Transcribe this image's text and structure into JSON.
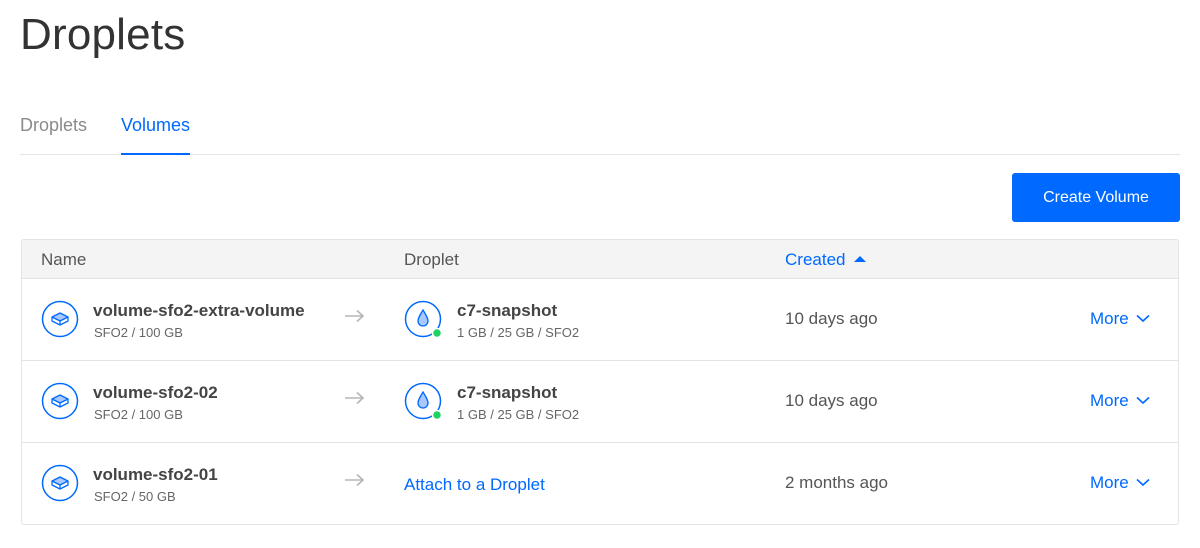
{
  "page": {
    "title": "Droplets"
  },
  "tabs": [
    {
      "label": "Droplets",
      "active": false
    },
    {
      "label": "Volumes",
      "active": true
    }
  ],
  "toolbar": {
    "create_label": "Create Volume"
  },
  "table": {
    "headers": {
      "name": "Name",
      "droplet": "Droplet",
      "created": "Created"
    },
    "sort": {
      "column": "created",
      "direction": "ascending"
    },
    "rows": [
      {
        "volume_name": "volume-sfo2-extra-volume",
        "volume_meta": "SFO2 / 100 GB",
        "droplet_name": "c7-snapshot",
        "droplet_meta": "1 GB / 25 GB / SFO2",
        "droplet_status": "active",
        "created": "10 days ago",
        "more_label": "More"
      },
      {
        "volume_name": "volume-sfo2-02",
        "volume_meta": "SFO2 / 100 GB",
        "droplet_name": "c7-snapshot",
        "droplet_meta": "1 GB / 25 GB / SFO2",
        "droplet_status": "active",
        "created": "10 days ago",
        "more_label": "More"
      },
      {
        "volume_name": "volume-sfo2-01",
        "volume_meta": "SFO2 / 50 GB",
        "attach_label": "Attach to a Droplet",
        "created": "2 months ago",
        "more_label": "More"
      }
    ]
  },
  "colors": {
    "accent": "#0069ff",
    "status_active": "#1fd264",
    "border": "#e3e3e3",
    "header_bg": "#f4f4f4"
  },
  "icons": {
    "volume": "volume-disk-icon",
    "droplet": "droplet-icon",
    "arrow": "arrow-right-icon",
    "chevron": "chevron-down-icon",
    "sort": "sort-ascending-icon"
  }
}
